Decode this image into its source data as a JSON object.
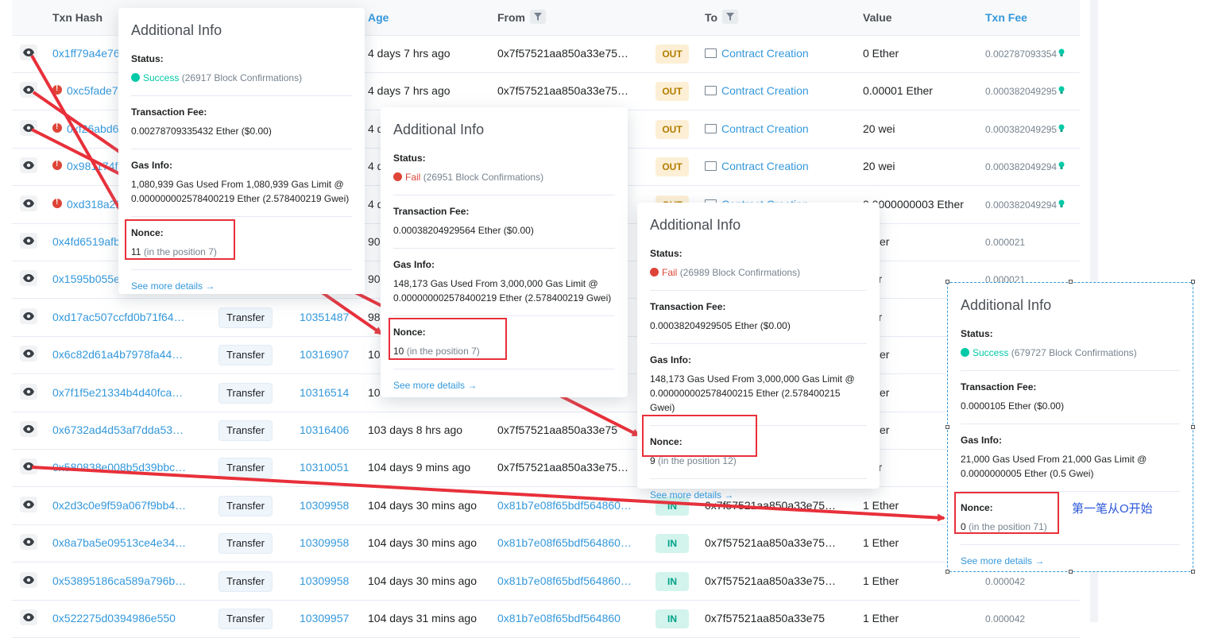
{
  "table": {
    "headers": {
      "txn_hash": "Txn Hash",
      "age": "Age",
      "from": "From",
      "to": "To",
      "value": "Value",
      "txn_fee": "Txn Fee"
    },
    "rows": [
      {
        "hash": "0x1ff79a4e76",
        "error": false,
        "method": "",
        "block": "",
        "age": "4 days 7 hrs ago",
        "from": "0x7f57521aa850a33e75…",
        "from_link": false,
        "dir": "OUT",
        "to": "Contract Creation",
        "to_contract": true,
        "value": "0 Ether",
        "fee": "0.002787093354",
        "fee_icon": true
      },
      {
        "hash": "0xc5fade7",
        "error": true,
        "method": "",
        "block": "",
        "age": "4 days 7 hrs ago",
        "from": "0x7f57521aa850a33e75…",
        "from_link": false,
        "dir": "OUT",
        "to": "Contract Creation",
        "to_contract": true,
        "value": "0.00001 Ether",
        "fee": "0.000382049295",
        "fee_icon": true
      },
      {
        "hash": "0xf26abd6",
        "error": true,
        "method": "",
        "block": "",
        "age": "4 d",
        "from": "",
        "from_link": false,
        "dir": "OUT",
        "to": "Contract Creation",
        "to_contract": true,
        "value": "20 wei",
        "fee": "0.000382049295",
        "fee_icon": true
      },
      {
        "hash": "0x981174f",
        "error": true,
        "method": "",
        "block": "",
        "age": "4 d",
        "from": "",
        "from_link": false,
        "dir": "OUT",
        "to": "Contract Creation",
        "to_contract": true,
        "value": "20 wei",
        "fee": "0.000382049294",
        "fee_icon": true
      },
      {
        "hash": "0xd318a22",
        "error": true,
        "method": "",
        "block": "",
        "age": "4 d",
        "from": "",
        "from_link": false,
        "dir": "OUT",
        "to": "Contract Creation",
        "to_contract": true,
        "value": "0.0000000003 Ether",
        "fee": "0.000382049294",
        "fee_icon": true
      },
      {
        "hash": "0x4fd6519afb",
        "error": false,
        "method": "",
        "block": "",
        "age": "90",
        "from": "",
        "from_link": false,
        "dir": "",
        "to": "",
        "to_contract": false,
        "value": "Ether",
        "fee": "0.000021",
        "fee_icon": false
      },
      {
        "hash": "0x1595b055e",
        "error": false,
        "method": "",
        "block": "",
        "age": "90",
        "from": "",
        "from_link": false,
        "dir": "",
        "to": "",
        "to_contract": false,
        "value": "ther",
        "fee": "0.000021",
        "fee_icon": false
      },
      {
        "hash": "0xd17ac507ccfd0b71f64…",
        "error": false,
        "method": "Transfer",
        "block": "10351487",
        "age": "98",
        "from": "",
        "from_link": false,
        "dir": "",
        "to": "",
        "to_contract": false,
        "value": "ther",
        "fee": "",
        "fee_icon": false
      },
      {
        "hash": "0x6c82d61a4b7978fa44…",
        "error": false,
        "method": "Transfer",
        "block": "10316907",
        "age": "10:",
        "from": "",
        "from_link": false,
        "dir": "",
        "to": "",
        "to_contract": false,
        "value": "Ether",
        "fee": "",
        "fee_icon": false
      },
      {
        "hash": "0x7f1f5e21334b4d40fca…",
        "error": false,
        "method": "Transfer",
        "block": "10316514",
        "age": "10:",
        "from": "",
        "from_link": false,
        "dir": "",
        "to": "",
        "to_contract": false,
        "value": "Ether",
        "fee": "",
        "fee_icon": false
      },
      {
        "hash": "0x6732ad4d53af7dda53…",
        "error": false,
        "method": "Transfer",
        "block": "10316406",
        "age": "103 days 8 hrs ago",
        "from": "0x7f57521aa850a33e75",
        "from_link": false,
        "dir": "",
        "to": "",
        "to_contract": false,
        "value": "Ether",
        "fee": "",
        "fee_icon": false
      },
      {
        "hash": "0x580838e008b5d39bbc…",
        "error": false,
        "method": "Transfer",
        "block": "10310051",
        "age": "104 days 9 mins ago",
        "from": "0x7f57521aa850a33e75…",
        "from_link": false,
        "dir": "",
        "to": "",
        "to_contract": false,
        "value": "ther",
        "fee": "",
        "fee_icon": false
      },
      {
        "hash": "0x2d3c0e9f59a067f9bb4…",
        "error": false,
        "method": "Transfer",
        "block": "10309958",
        "age": "104 days 30 mins ago",
        "from": "0x81b7e08f65bdf564860…",
        "from_link": true,
        "dir": "IN",
        "to": "0x7f57521aa850a33e75…",
        "to_contract": false,
        "value": "1 Ether",
        "fee": "",
        "fee_icon": false
      },
      {
        "hash": "0x8a7ba5e09513ce4e34…",
        "error": false,
        "method": "Transfer",
        "block": "10309958",
        "age": "104 days 30 mins ago",
        "from": "0x81b7e08f65bdf564860…",
        "from_link": true,
        "dir": "IN",
        "to": "0x7f57521aa850a33e75…",
        "to_contract": false,
        "value": "1 Ether",
        "fee": "",
        "fee_icon": false
      },
      {
        "hash": "0x53895186ca589a796b…",
        "error": false,
        "method": "Transfer",
        "block": "10309958",
        "age": "104 days 30 mins ago",
        "from": "0x81b7e08f65bdf564860…",
        "from_link": true,
        "dir": "IN",
        "to": "0x7f57521aa850a33e75…",
        "to_contract": false,
        "value": "1 Ether",
        "fee": "0.000042",
        "fee_icon": false
      },
      {
        "hash": "0x522275d0394986e550",
        "error": false,
        "method": "Transfer",
        "block": "10309957",
        "age": "104 days 31 mins ago",
        "from": "0x81b7e08f65bdf564860",
        "from_link": true,
        "dir": "IN",
        "to": "0x7f57521aa850a33e75",
        "to_contract": false,
        "value": "1 Ether",
        "fee": "0.000042",
        "fee_icon": false
      }
    ]
  },
  "popups": [
    {
      "title": "Additional Info",
      "status_label": "Status:",
      "status_ok": true,
      "status_text": "Success",
      "status_conf": "(26917 Block Confirmations)",
      "fee_label": "Transaction Fee:",
      "fee_value": "0.00278709335432 Ether ($0.00)",
      "gas_label": "Gas Info:",
      "gas_value": "1,080,939 Gas Used From 1,080,939 Gas Limit @ 0.000000002578400219 Ether (2.578400219 Gwei)",
      "nonce_label": "Nonce:",
      "nonce_value": "11",
      "nonce_pos": "(in the position 7)",
      "more": "See more details →"
    },
    {
      "title": "Additional Info",
      "status_label": "Status:",
      "status_ok": false,
      "status_text": "Fail",
      "status_conf": "(26951 Block Confirmations)",
      "fee_label": "Transaction Fee:",
      "fee_value": "0.00038204929564 Ether ($0.00)",
      "gas_label": "Gas Info:",
      "gas_value": "148,173 Gas Used From 3,000,000 Gas Limit @ 0.000000002578400219 Ether (2.578400219 Gwei)",
      "nonce_label": "Nonce:",
      "nonce_value": "10",
      "nonce_pos": "(in the position 7)",
      "more": "See more details →"
    },
    {
      "title": "Additional Info",
      "status_label": "Status:",
      "status_ok": false,
      "status_text": "Fail",
      "status_conf": "(26989 Block Confirmations)",
      "fee_label": "Transaction Fee:",
      "fee_value": "0.00038204929505 Ether ($0.00)",
      "gas_label": "Gas Info:",
      "gas_value": "148,173 Gas Used From 3,000,000 Gas Limit @ 0.000000002578400215 Ether (2.578400215 Gwei)",
      "nonce_label": "Nonce:",
      "nonce_value": "9",
      "nonce_pos": "(in the position 12)",
      "more": "See more details →"
    },
    {
      "title": "Additional Info",
      "status_label": "Status:",
      "status_ok": true,
      "status_text": "Success",
      "status_conf": "(679727 Block Confirmations)",
      "fee_label": "Transaction Fee:",
      "fee_value": "0.0000105 Ether ($0.00)",
      "gas_label": "Gas Info:",
      "gas_value": "21,000 Gas Used From 21,000 Gas Limit @ 0.0000000005 Ether (0.5 Gwei)",
      "nonce_label": "Nonce:",
      "nonce_value": "0",
      "nonce_pos": "(in the position 71)",
      "more": "See more details →"
    }
  ],
  "annotation": {
    "note": "第一笔从O开始",
    "color": "#e8303a"
  },
  "colors": {
    "link": "#3498db",
    "success": "#00c9a7",
    "fail": "#de4437",
    "out_badge": "#fcefd5",
    "in_badge": "#d2f4ed"
  }
}
